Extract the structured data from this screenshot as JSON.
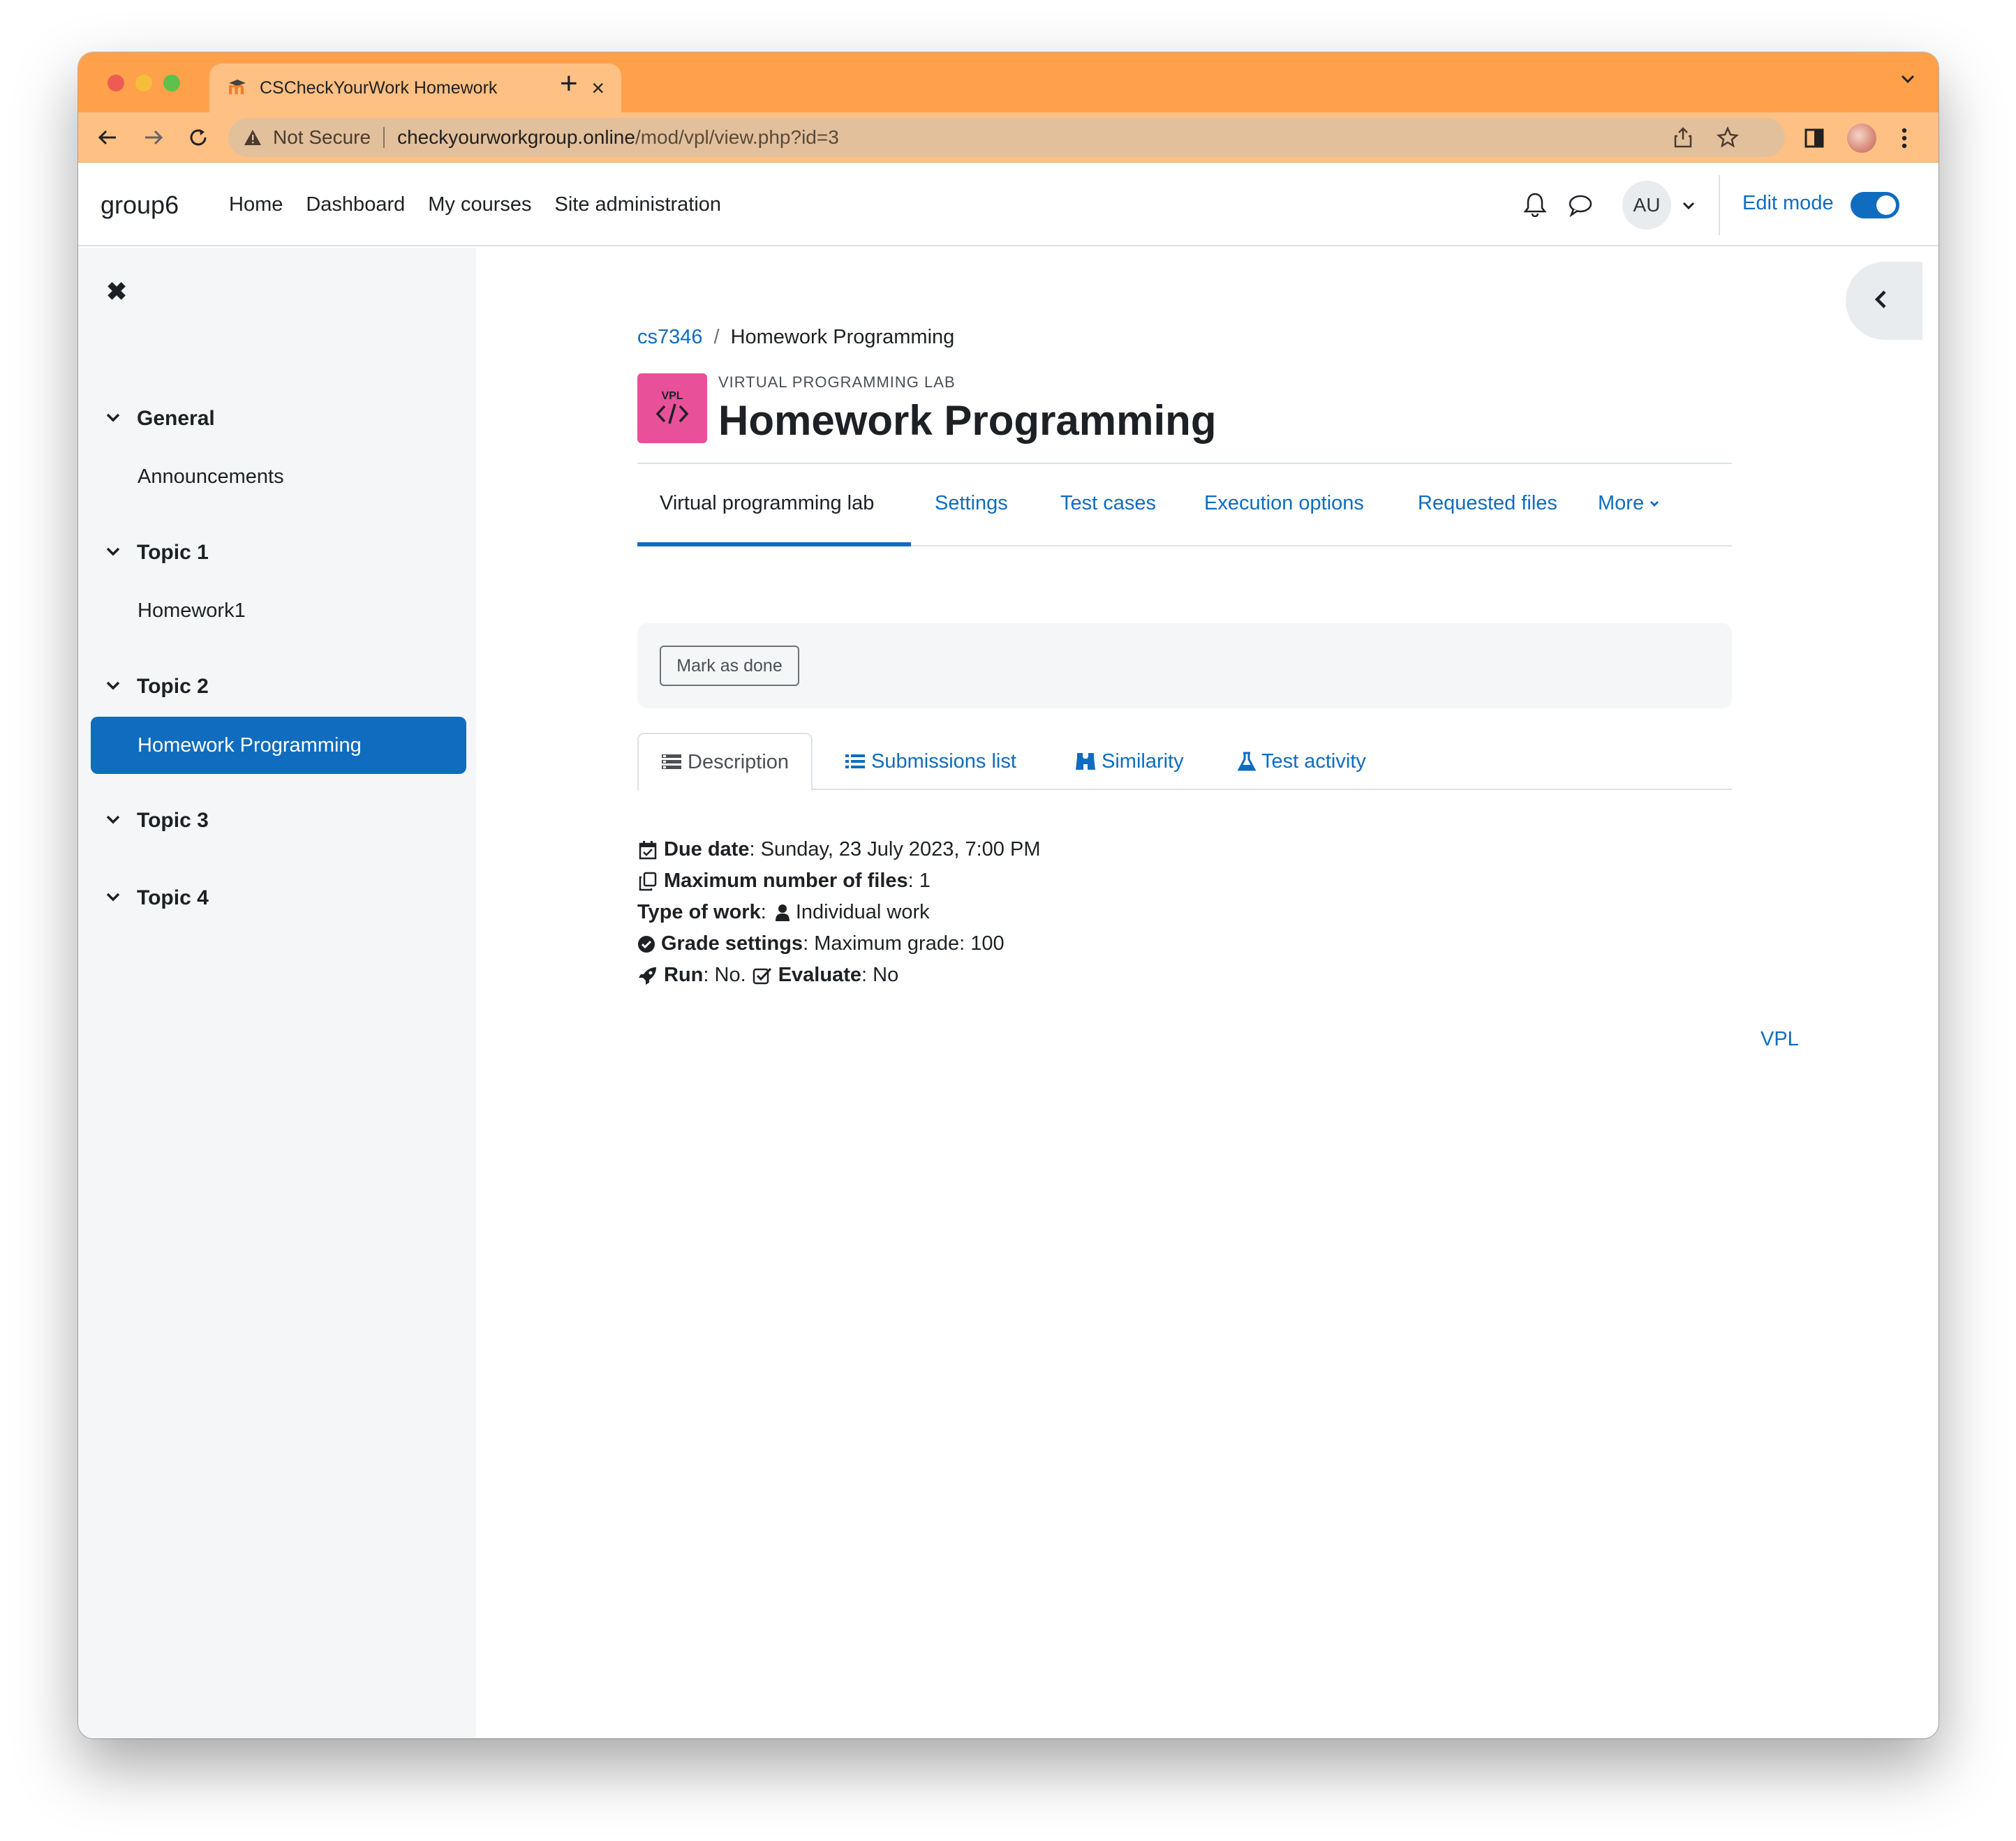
{
  "browser": {
    "tab_title": "CSCheckYourWork Homework",
    "security_label": "Not Secure",
    "url_domain": "checkyourworkgroup.online",
    "url_path": "/mod/vpl/view.php?id=3"
  },
  "navbar": {
    "brand": "group6",
    "links": [
      "Home",
      "Dashboard",
      "My courses",
      "Site administration"
    ],
    "avatar_initials": "AU",
    "edit_mode_label": "Edit mode",
    "edit_mode_on": true
  },
  "drawer": {
    "sections": [
      {
        "title": "General",
        "items": [
          "Announcements"
        ]
      },
      {
        "title": "Topic 1",
        "items": [
          "Homework1"
        ]
      },
      {
        "title": "Topic 2",
        "items": [
          "Homework Programming"
        ]
      },
      {
        "title": "Topic 3",
        "items": []
      },
      {
        "title": "Topic 4",
        "items": []
      }
    ],
    "active_item": "Homework Programming"
  },
  "page": {
    "breadcrumb": [
      "cs7346",
      "Homework Programming"
    ],
    "breadcrumb_sep": "/",
    "icon_text": "VPL",
    "module_type": "VIRTUAL PROGRAMMING LAB",
    "title": "Homework Programming",
    "secondary_nav": [
      "Virtual programming lab",
      "Settings",
      "Test cases",
      "Execution options",
      "Requested files",
      "More"
    ],
    "mark_done_label": "Mark as done",
    "tabs": [
      "Description",
      "Submissions list",
      "Similarity",
      "Test activity"
    ],
    "details": {
      "due_date_label": "Due date",
      "due_date_value": "Sunday, 23 July 2023, 7:00 PM",
      "max_files_label": "Maximum number of files",
      "max_files_value": "1",
      "type_label": "Type of work",
      "type_value": "Individual work",
      "grade_label": "Grade settings",
      "grade_value": "Maximum grade: 100",
      "run_label": "Run",
      "run_value": "No.",
      "evaluate_label": "Evaluate",
      "evaluate_value": "No"
    },
    "footer_link": "VPL",
    "help_label": "?"
  },
  "colors": {
    "browser_frame": "#ffa14a",
    "brand_blue": "#0f6cbf",
    "vpl_icon": "#e8509a"
  }
}
